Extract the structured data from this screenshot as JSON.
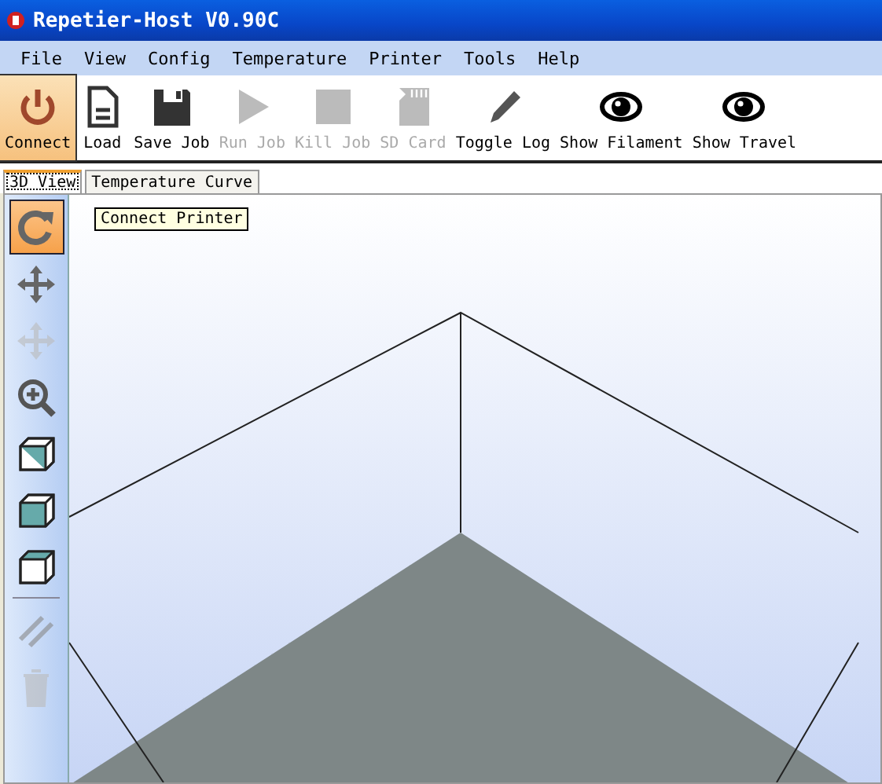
{
  "window": {
    "title": "Repetier-Host V0.90C"
  },
  "menu": [
    "File",
    "View",
    "Config",
    "Temperature",
    "Printer",
    "Tools",
    "Help"
  ],
  "toolbar": [
    {
      "label": "Connect",
      "selected": true,
      "disabled": false
    },
    {
      "label": "Load",
      "selected": false,
      "disabled": false
    },
    {
      "label": "Save Job",
      "selected": false,
      "disabled": false
    },
    {
      "label": "Run Job",
      "selected": false,
      "disabled": true
    },
    {
      "label": "Kill Job",
      "selected": false,
      "disabled": true
    },
    {
      "label": "SD Card",
      "selected": false,
      "disabled": true
    },
    {
      "label": "Toggle Log",
      "selected": false,
      "disabled": false
    },
    {
      "label": "Show Filament",
      "selected": false,
      "disabled": false
    },
    {
      "label": "Show Travel",
      "selected": false,
      "disabled": false
    }
  ],
  "tooltip": "Connect Printer",
  "tabs": [
    {
      "label": "3D View",
      "selected": true
    },
    {
      "label": "Temperature Curve",
      "selected": false
    }
  ],
  "view_tools": [
    {
      "selected": true,
      "disabled": false
    },
    {
      "selected": false,
      "disabled": false
    },
    {
      "selected": false,
      "disabled": true
    },
    {
      "selected": false,
      "disabled": false
    },
    {
      "selected": false,
      "disabled": false
    },
    {
      "selected": false,
      "disabled": false
    },
    {
      "selected": false,
      "disabled": false
    },
    {
      "selected": false,
      "disabled": true
    },
    {
      "selected": false,
      "disabled": true
    }
  ]
}
